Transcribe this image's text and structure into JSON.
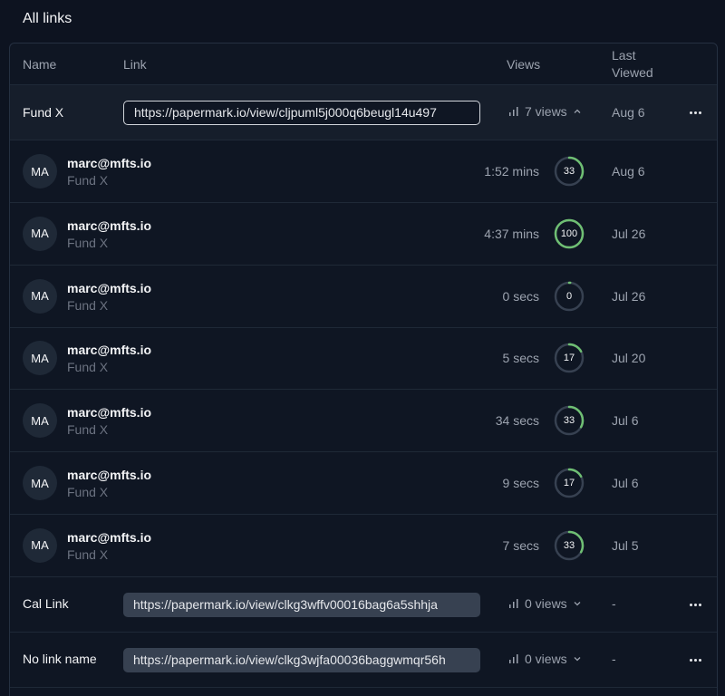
{
  "page": {
    "title": "All links"
  },
  "table": {
    "headers": {
      "name": "Name",
      "link": "Link",
      "views": "Views",
      "last_viewed": "Last Viewed"
    }
  },
  "links": [
    {
      "name": "Fund X",
      "url": "https://papermark.io/view/cljpuml5j000q6beugl14u497",
      "views_label": "7 views",
      "expanded": true,
      "last_viewed": "Aug 6",
      "visits": [
        {
          "initials": "MA",
          "email": "marc@mfts.io",
          "document": "Fund X",
          "duration": "1:52 mins",
          "completion": 33,
          "date": "Aug 6"
        },
        {
          "initials": "MA",
          "email": "marc@mfts.io",
          "document": "Fund X",
          "duration": "4:37 mins",
          "completion": 100,
          "date": "Jul 26"
        },
        {
          "initials": "MA",
          "email": "marc@mfts.io",
          "document": "Fund X",
          "duration": "0 secs",
          "completion": 0,
          "date": "Jul 26"
        },
        {
          "initials": "MA",
          "email": "marc@mfts.io",
          "document": "Fund X",
          "duration": "5 secs",
          "completion": 17,
          "date": "Jul 20"
        },
        {
          "initials": "MA",
          "email": "marc@mfts.io",
          "document": "Fund X",
          "duration": "34 secs",
          "completion": 33,
          "date": "Jul 6"
        },
        {
          "initials": "MA",
          "email": "marc@mfts.io",
          "document": "Fund X",
          "duration": "9 secs",
          "completion": 17,
          "date": "Jul 6"
        },
        {
          "initials": "MA",
          "email": "marc@mfts.io",
          "document": "Fund X",
          "duration": "7 secs",
          "completion": 33,
          "date": "Jul 5"
        }
      ]
    },
    {
      "name": "Cal Link",
      "url": "https://papermark.io/view/clkg3wffv00016bag6a5shhja",
      "views_label": "0 views",
      "expanded": false,
      "last_viewed": "-"
    },
    {
      "name": "No link name",
      "url": "https://papermark.io/view/clkg3wjfa00036baggwmqr56h",
      "views_label": "0 views",
      "expanded": false,
      "last_viewed": "-"
    }
  ],
  "colors": {
    "ring_progress": "#6fbf73",
    "ring_track": "#374151",
    "background": "#0d1320"
  },
  "icons": {
    "views": "bar-chart-icon",
    "expanded": "chevron-up-icon",
    "collapsed": "chevron-down-icon",
    "more": "ellipsis-icon"
  }
}
